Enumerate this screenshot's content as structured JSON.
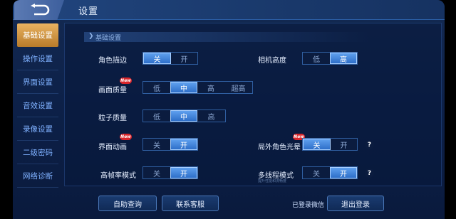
{
  "header": {
    "title": "设置"
  },
  "sidebar": {
    "items": [
      {
        "label": "基础设置"
      },
      {
        "label": "操作设置"
      },
      {
        "label": "界面设置"
      },
      {
        "label": "音效设置"
      },
      {
        "label": "录像设置"
      },
      {
        "label": "二级密码"
      },
      {
        "label": "网络诊断"
      }
    ]
  },
  "section": {
    "title": "基础设置"
  },
  "settings": {
    "outline": {
      "label": "角色描边",
      "options": [
        "关",
        "开"
      ],
      "selected": "关"
    },
    "camera": {
      "label": "相机高度",
      "options": [
        "低",
        "高"
      ],
      "selected": "高"
    },
    "quality": {
      "label": "画面质量",
      "badge": "New",
      "options": [
        "低",
        "中",
        "高",
        "超高"
      ],
      "selected": "中"
    },
    "particles": {
      "label": "粒子质量",
      "options": [
        "低",
        "中",
        "高"
      ],
      "selected": "中"
    },
    "ui_anim": {
      "label": "界面动画",
      "badge": "New",
      "options": [
        "关",
        "开"
      ],
      "selected": "开"
    },
    "halo": {
      "label": "局外角色光晕",
      "badge": "New",
      "options": [
        "关",
        "开"
      ],
      "selected": "关",
      "help": "?"
    },
    "hfr": {
      "label": "高帧率模式",
      "options": [
        "关",
        "开"
      ],
      "selected": "开"
    },
    "multithread": {
      "label": "多线程模式",
      "options": [
        "关",
        "开"
      ],
      "selected": "开",
      "help": "?",
      "subtext": "提升性能和流畅度"
    }
  },
  "footer": {
    "self_query": "自助查询",
    "contact": "联系客服",
    "logged_in": "已登录微信",
    "logout": "退出登录"
  },
  "colors": {
    "accent": "#2e6fc9",
    "active_tab": "#e8b261",
    "badge": "#d9262b"
  }
}
